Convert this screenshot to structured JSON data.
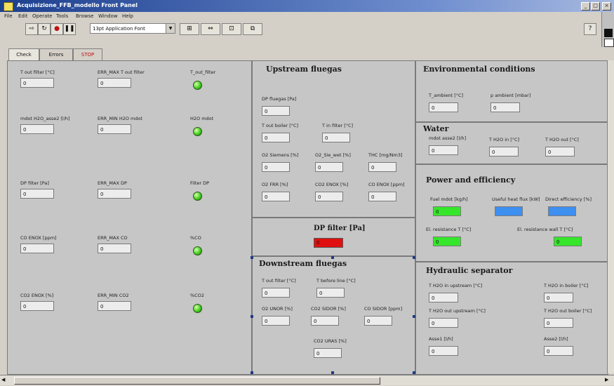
{
  "window": {
    "title": "Acquisizione_FFB_modello Front Panel",
    "controls": [
      "_",
      "□",
      "×"
    ]
  },
  "menu": [
    "File",
    "Edit",
    "Operate",
    "Tools",
    "Browse",
    "Window",
    "Help"
  ],
  "toolbar": {
    "font": "13pt Application Font"
  },
  "tabs": [
    {
      "label": "Check"
    },
    {
      "label": "Errors"
    },
    {
      "label": "STOP"
    }
  ],
  "left_rows": [
    {
      "value_label": "T out filter [°C]",
      "max_label": "ERR_MAX T out filter",
      "led_label": "T_out_filter",
      "value": "0",
      "max": "0"
    },
    {
      "value_label": "mdot H2O_asse2 [l/h]",
      "max_label": "ERR_MIN H2O mdot",
      "led_label": "H2O mdot",
      "value": "0",
      "max": "0"
    },
    {
      "value_label": "DP filter [Pa]",
      "max_label": "ERR_MAX DP",
      "led_label": "Filter DP",
      "value": "0",
      "max": "0"
    },
    {
      "value_label": "CO ENOX [ppm]",
      "max_label": "ERR_MAX CO",
      "led_label": "%CO",
      "value": "0",
      "max": "0"
    },
    {
      "value_label": "CO2 ENOX [%]",
      "max_label": "ERR_MIN CO2",
      "led_label": "%CO2",
      "value": "0",
      "max": "0"
    }
  ],
  "upstream": {
    "title": "Upstream fluegas",
    "fields": [
      {
        "label": "DP fluegas [Pa]",
        "value": "0"
      },
      {
        "label": "T out boiler [°C]",
        "value": "0"
      },
      {
        "label": "T in filter [°C]",
        "value": "0"
      },
      {
        "label": "O2 Siemens [%]",
        "value": "0"
      },
      {
        "label": "O2_Sie_wet [%]",
        "value": "0"
      },
      {
        "label": "THC [mg/Nm3]",
        "value": "0"
      },
      {
        "label": "O2 FRR [%]",
        "value": "0"
      },
      {
        "label": "CO2 ENOX [%]",
        "value": "0"
      },
      {
        "label": "CO ENOX [ppm]",
        "value": "0"
      }
    ]
  },
  "dp_filter": {
    "label": "DP filter [Pa]",
    "value": "0",
    "color": "#e01010"
  },
  "downstream": {
    "title": "Downstream fluegas",
    "fields": [
      {
        "label": "T out filter [°C]",
        "value": "0"
      },
      {
        "label": "T before line [°C]",
        "value": "0"
      },
      {
        "label": "O2 UNOR [%]",
        "value": "0"
      },
      {
        "label": "CO2 SIDOR [%]",
        "value": "0"
      },
      {
        "label": "CO SIDOR [ppm]",
        "value": "0"
      },
      {
        "label": "CO2 URAS [%]",
        "value": "0"
      }
    ]
  },
  "environment": {
    "title": "Environmental conditions",
    "fields": [
      {
        "label": "T_ambient [°C]",
        "value": "0"
      },
      {
        "label": "p ambient [mbar]",
        "value": "0"
      }
    ]
  },
  "water": {
    "title": "Water",
    "fields": [
      {
        "label": "mdot asse2 [l/h]",
        "value": "0"
      },
      {
        "label": "T H2O in [°C]",
        "value": "0"
      },
      {
        "label": "T H2O out [°C]",
        "value": "0"
      }
    ]
  },
  "power": {
    "title": "Power and efficiency",
    "fields": [
      {
        "label": "Fuel mdot [kg/h]",
        "value": "0",
        "color": "#35e62a"
      },
      {
        "label": "Useful heat flux [kW]",
        "value": "",
        "color": "#3d8ff0"
      },
      {
        "label": "Direct efficiency [%]",
        "value": "",
        "color": "#3d8ff0"
      },
      {
        "label": "El. resistance T [°C]",
        "value": "0",
        "color": "#35e62a"
      },
      {
        "label": "El. resistance wall T [°C]",
        "value": "0",
        "color": "#35e62a"
      }
    ]
  },
  "hydraulic": {
    "title": "Hydraulic separator",
    "fields": [
      {
        "label": "T H2O in upstream [°C]",
        "value": "0"
      },
      {
        "label": "T H2O in boiler [°C]",
        "value": "0"
      },
      {
        "label": "T H2O out upstream [°C]",
        "value": "0"
      },
      {
        "label": "T H2O out boiler [°C]",
        "value": "0"
      },
      {
        "label": "Asse1 [l/h]",
        "value": "0"
      },
      {
        "label": "Asse2 [l/h]",
        "value": "0"
      }
    ]
  }
}
